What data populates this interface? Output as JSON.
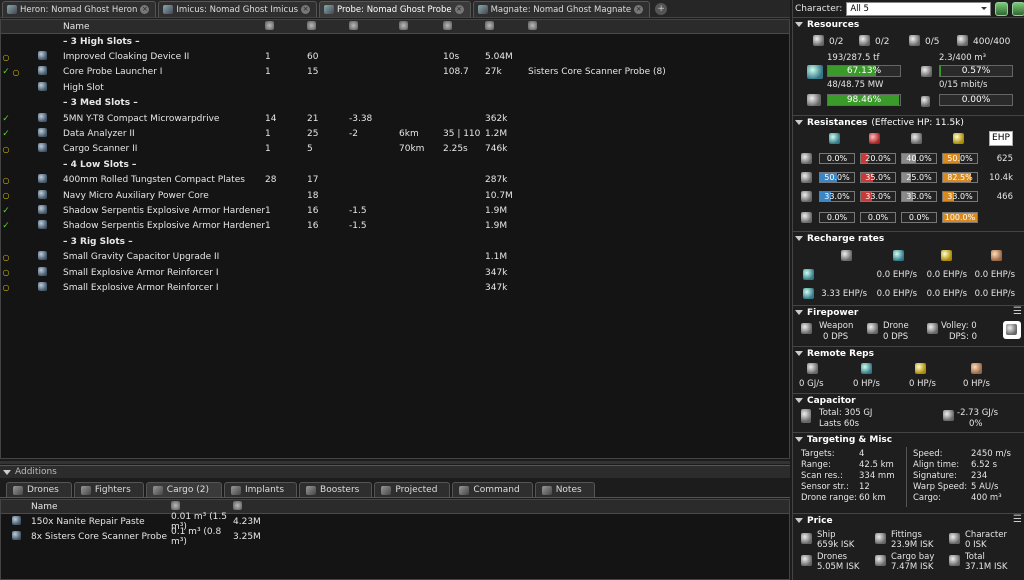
{
  "fit_tabs": [
    {
      "label": "Heron: Nomad Ghost Heron"
    },
    {
      "label": "Imicus: Nomad Ghost Imicus"
    },
    {
      "label": "Probe: Nomad Ghost Probe"
    },
    {
      "label": "Magnate: Nomad Ghost Magnate"
    }
  ],
  "fitting": {
    "name_header": "Name",
    "rows": [
      {
        "type": "section",
        "name": "– 3 High Slots –"
      },
      {
        "state": "o",
        "icon": "cloak-icon",
        "name": "Improved Cloaking Device II",
        "c4": "1",
        "c5": "60",
        "c6": "",
        "c7": "",
        "c8": "10s",
        "c9": "5.04M",
        "c10": ""
      },
      {
        "state": "v",
        "charge": "o",
        "icon": "probe-launcher-icon",
        "name": "Core Probe Launcher I",
        "c4": "1",
        "c5": "15",
        "c6": "",
        "c7": "",
        "c8": "108.7",
        "c9": "27k",
        "c10": "Sisters Core Scanner Probe (8)"
      },
      {
        "state": "",
        "icon": "empty-slot-icon",
        "name": "High Slot",
        "c4": "",
        "c5": "",
        "c6": "",
        "c7": "",
        "c8": "",
        "c9": "",
        "c10": ""
      },
      {
        "type": "section",
        "name": "– 3 Med Slots –"
      },
      {
        "state": "v",
        "icon": "microwarpdrive-icon",
        "name": "5MN Y-T8 Compact Microwarpdrive",
        "c4": "14",
        "c5": "21",
        "c6": "-3.38",
        "c7": "",
        "c8": "",
        "c9": "362k",
        "c10": ""
      },
      {
        "state": "v",
        "icon": "data-analyzer-icon",
        "name": "Data Analyzer II",
        "c4": "1",
        "c5": "25",
        "c6": "-2",
        "c7": "6km",
        "c8": "35 | 110",
        "c9": "1.2M",
        "c10": ""
      },
      {
        "state": "o",
        "icon": "cargo-scanner-icon",
        "name": "Cargo Scanner II",
        "c4": "1",
        "c5": "5",
        "c6": "",
        "c7": "70km",
        "c8": "2.25s",
        "c9": "746k",
        "c10": ""
      },
      {
        "type": "section",
        "name": "– 4 Low Slots –"
      },
      {
        "state": "o",
        "icon": "armor-plate-icon",
        "name": "400mm Rolled Tungsten Compact Plates",
        "c4": "28",
        "c5": "17",
        "c6": "",
        "c7": "",
        "c8": "",
        "c9": "287k",
        "c10": ""
      },
      {
        "state": "o",
        "icon": "power-core-icon",
        "name": "Navy Micro Auxiliary Power Core",
        "c4": "",
        "c5": "18",
        "c6": "",
        "c7": "",
        "c8": "",
        "c9": "10.7M",
        "c10": ""
      },
      {
        "state": "v",
        "icon": "armor-hardener-icon",
        "name": "Shadow Serpentis Explosive Armor Hardener",
        "c4": "1",
        "c5": "16",
        "c6": "-1.5",
        "c7": "",
        "c8": "",
        "c9": "1.9M",
        "c10": ""
      },
      {
        "state": "v",
        "icon": "armor-hardener-icon",
        "name": "Shadow Serpentis Explosive Armor Hardener",
        "c4": "1",
        "c5": "16",
        "c6": "-1.5",
        "c7": "",
        "c8": "",
        "c9": "1.9M",
        "c10": ""
      },
      {
        "type": "section",
        "name": "– 3 Rig Slots –"
      },
      {
        "state": "o",
        "icon": "capacitor-rig-icon",
        "name": "Small Gravity Capacitor Upgrade II",
        "c4": "",
        "c5": "",
        "c6": "",
        "c7": "",
        "c8": "",
        "c9": "1.1M",
        "c10": ""
      },
      {
        "state": "o",
        "icon": "armor-rig-icon",
        "name": "Small Explosive Armor Reinforcer I",
        "c4": "",
        "c5": "",
        "c6": "",
        "c7": "",
        "c8": "",
        "c9": "347k",
        "c10": ""
      },
      {
        "state": "o",
        "icon": "armor-rig-icon",
        "name": "Small Explosive Armor Reinforcer I",
        "c4": "",
        "c5": "",
        "c6": "",
        "c7": "",
        "c8": "",
        "c9": "347k",
        "c10": ""
      }
    ]
  },
  "additions": {
    "title": "Additions",
    "tabs": [
      "Drones",
      "Fighters",
      "Cargo (2)",
      "Implants",
      "Boosters",
      "Projected",
      "Command",
      "Notes"
    ],
    "name_header": "Name",
    "rows": [
      {
        "name": "150x Nanite Repair Paste",
        "vol": "0.01 m³ (1.5 m³)",
        "price": "4.23M"
      },
      {
        "name": "8x Sisters Core Scanner Probe",
        "vol": "0.1 m³ (0.8 m³)",
        "price": "3.25M"
      }
    ]
  },
  "character": {
    "label": "Character:",
    "value": "All 5"
  },
  "resources": {
    "title": "Resources",
    "hardpoints": [
      "0/2",
      "0/2",
      "0/5",
      "400/400"
    ],
    "cpu": "193/287.5 tf",
    "cpu_pct": "67.13%",
    "cpu_pct_value": 67.13,
    "powergrid": "48/48.75 MW",
    "pg_pct": "98.46%",
    "pg_pct_value": 98.46,
    "drone_bay": "2.3/400 m³",
    "drone_bay_pct": "0.57%",
    "drone_bay_pct_value": 0.57,
    "bandwidth": "0/15 mbit/s",
    "bandwidth_pct": "0.00%",
    "bandwidth_pct_value": 0
  },
  "resistances": {
    "title": "Resistances",
    "ehp_label": "(Effective HP: 11.5k)",
    "ehp_button": "EHP",
    "rows": [
      {
        "vals": [
          "0.0%",
          "20.0%",
          "40.0%",
          "50.0%"
        ],
        "num": [
          0,
          20,
          40,
          50
        ],
        "hp": "625"
      },
      {
        "vals": [
          "50.0%",
          "35.0%",
          "25.0%",
          "82.5%"
        ],
        "num": [
          50,
          35,
          25,
          82.5
        ],
        "hp": "10.4k"
      },
      {
        "vals": [
          "33.0%",
          "33.0%",
          "33.0%",
          "33.0%"
        ],
        "num": [
          33,
          33,
          33,
          33
        ],
        "hp": "466"
      },
      {
        "vals": [
          "0.0%",
          "0.0%",
          "0.0%",
          "100.0%"
        ],
        "num": [
          0,
          0,
          0,
          100
        ],
        "hp": ""
      }
    ]
  },
  "recharge": {
    "title": "Recharge rates",
    "row1": [
      "0.0 EHP/s",
      "0.0 EHP/s",
      "0.0 EHP/s"
    ],
    "row2": [
      "3.33 EHP/s",
      "0.0 EHP/s",
      "0.0 EHP/s",
      "0.0 EHP/s"
    ]
  },
  "firepower": {
    "title": "Firepower",
    "weapon": "Weapon",
    "weapon_dps": "0 DPS",
    "drone": "Drone",
    "drone_dps": "0 DPS",
    "volley": "Volley: 0",
    "dps": "DPS: 0"
  },
  "remote": {
    "title": "Remote Reps",
    "vals": [
      "0 GJ/s",
      "0 HP/s",
      "0 HP/s",
      "0 HP/s"
    ]
  },
  "capacitor": {
    "title": "Capacitor",
    "total": "Total: 305 GJ",
    "lasts": "Lasts 60s",
    "delta": "-2.73 GJ/s",
    "pct": "0%"
  },
  "targeting": {
    "title": "Targeting & Misc",
    "left": [
      [
        "Targets:",
        "4"
      ],
      [
        "Range:",
        "42.5 km"
      ],
      [
        "Scan res.:",
        "334 mm"
      ],
      [
        "Sensor str.:",
        "12"
      ],
      [
        "Drone range:",
        "60 km"
      ]
    ],
    "right": [
      [
        "Speed:",
        "2450 m/s"
      ],
      [
        "Align time:",
        "6.52 s"
      ],
      [
        "Signature:",
        "234"
      ],
      [
        "Warp Speed:",
        "5 AU/s"
      ],
      [
        "Cargo:",
        "400 m³"
      ]
    ]
  },
  "price": {
    "title": "Price",
    "items": [
      {
        "label": "Ship",
        "value": "659k ISK"
      },
      {
        "label": "Fittings",
        "value": "23.9M ISK"
      },
      {
        "label": "Character",
        "value": "0 ISK"
      },
      {
        "label": "Drones",
        "value": "5.05M ISK"
      },
      {
        "label": "Cargo bay",
        "value": "7.47M ISK"
      },
      {
        "label": "Total",
        "value": "37.1M ISK"
      }
    ]
  },
  "colors": {
    "bar_green": "#3a9a2a",
    "em": "#3a86c6",
    "thermal": "#c83a3a",
    "kinetic": "#8a8a8a",
    "explosive": "#d88a20"
  }
}
